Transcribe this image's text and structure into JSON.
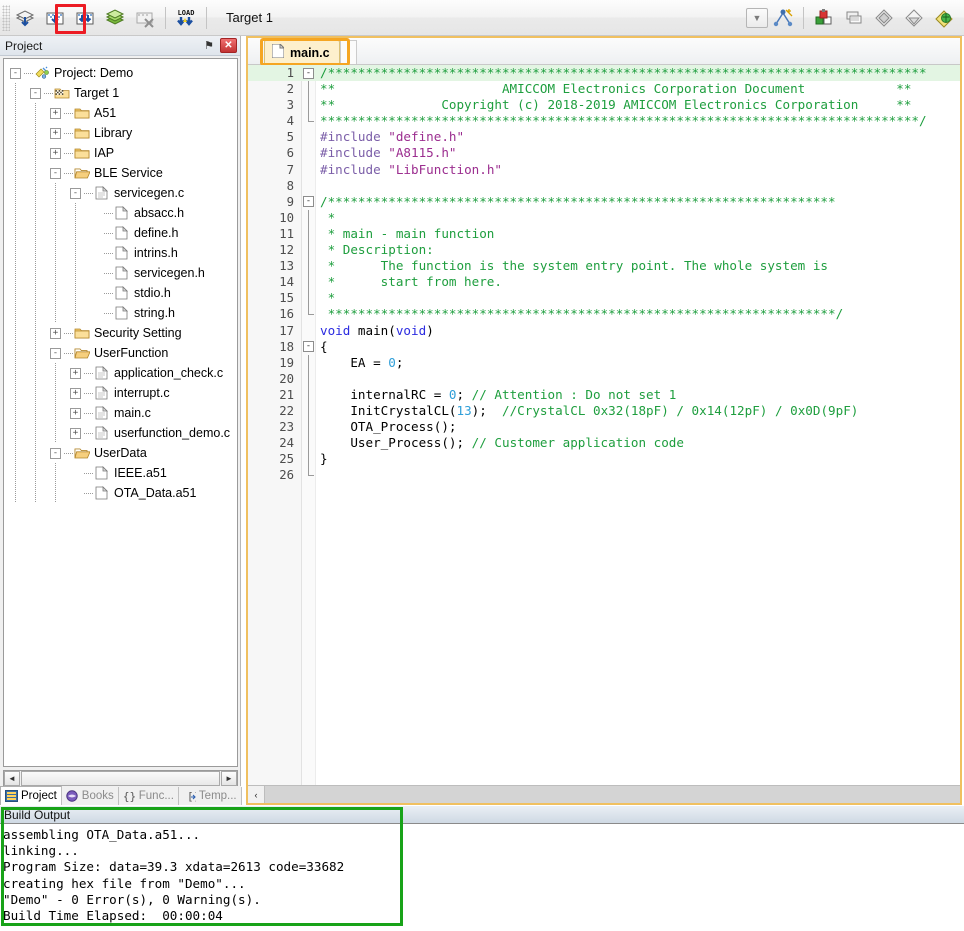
{
  "toolbar": {
    "target_value": "Target 1",
    "buttons": [
      {
        "name": "translate-icon",
        "label": "Translate"
      },
      {
        "name": "build-icon",
        "label": "Build"
      },
      {
        "name": "rebuild-icon",
        "label": "Rebuild"
      },
      {
        "name": "batch-build-icon",
        "label": "Batch Build"
      },
      {
        "name": "stop-build-icon",
        "label": "Stop Build"
      },
      {
        "name": "download-icon",
        "label": "Download"
      }
    ],
    "right_buttons": [
      {
        "name": "target-options-icon",
        "label": "Options for Target"
      },
      {
        "name": "manage-components-icon",
        "label": "Manage Project Items"
      },
      {
        "name": "manage-multi-project-icon",
        "label": "Manage Multi-Project"
      },
      {
        "name": "svcs-icon",
        "label": "Configure Source Control"
      },
      {
        "name": "svcs2-icon",
        "label": "Source Control 2"
      },
      {
        "name": "packs-icon",
        "label": "Pack Installer"
      }
    ],
    "highlight_color": "#ec1c24"
  },
  "project_panel": {
    "title": "Project",
    "pin_glyph": "⚑",
    "close_glyph": "✕",
    "tree": [
      {
        "depth": 0,
        "label": "Project: Demo",
        "icon": "project-icon",
        "toggle": "-"
      },
      {
        "depth": 1,
        "label": "Target 1",
        "icon": "target-icon",
        "toggle": "-"
      },
      {
        "depth": 2,
        "label": "A51",
        "icon": "folder-icon",
        "toggle": "+"
      },
      {
        "depth": 2,
        "label": "Library",
        "icon": "folder-icon",
        "toggle": "+"
      },
      {
        "depth": 2,
        "label": "IAP",
        "icon": "folder-icon",
        "toggle": "+"
      },
      {
        "depth": 2,
        "label": "BLE Service",
        "icon": "folder-open-icon",
        "toggle": "-"
      },
      {
        "depth": 3,
        "label": "servicegen.c",
        "icon": "c-file-icon",
        "toggle": "-"
      },
      {
        "depth": 4,
        "label": "absacc.h",
        "icon": "h-file-icon",
        "toggle": ""
      },
      {
        "depth": 4,
        "label": "define.h",
        "icon": "h-file-icon",
        "toggle": ""
      },
      {
        "depth": 4,
        "label": "intrins.h",
        "icon": "h-file-icon",
        "toggle": ""
      },
      {
        "depth": 4,
        "label": "servicegen.h",
        "icon": "h-file-icon",
        "toggle": ""
      },
      {
        "depth": 4,
        "label": "stdio.h",
        "icon": "h-file-icon",
        "toggle": ""
      },
      {
        "depth": 4,
        "label": "string.h",
        "icon": "h-file-icon",
        "toggle": ""
      },
      {
        "depth": 2,
        "label": "Security Setting",
        "icon": "folder-icon",
        "toggle": "+"
      },
      {
        "depth": 2,
        "label": "UserFunction",
        "icon": "folder-open-icon",
        "toggle": "-"
      },
      {
        "depth": 3,
        "label": "application_check.c",
        "icon": "c-file-icon",
        "toggle": "+"
      },
      {
        "depth": 3,
        "label": "interrupt.c",
        "icon": "c-file-icon",
        "toggle": "+"
      },
      {
        "depth": 3,
        "label": "main.c",
        "icon": "c-file-icon",
        "toggle": "+"
      },
      {
        "depth": 3,
        "label": "userfunction_demo.c",
        "icon": "c-file-icon",
        "toggle": "+"
      },
      {
        "depth": 2,
        "label": "UserData",
        "icon": "folder-open-icon",
        "toggle": "-"
      },
      {
        "depth": 3,
        "label": "IEEE.a51",
        "icon": "asm-file-icon",
        "toggle": ""
      },
      {
        "depth": 3,
        "label": "OTA_Data.a51",
        "icon": "asm-file-icon",
        "toggle": ""
      }
    ],
    "scroll_left_glyph": "◄",
    "scroll_right_glyph": "►",
    "tabs": [
      {
        "label": "Project",
        "icon": "project-tab-icon",
        "active": true
      },
      {
        "label": "Books",
        "icon": "books-tab-icon",
        "active": false
      },
      {
        "label": "Func...",
        "icon": "functions-tab-icon",
        "active": false
      },
      {
        "label": "Temp...",
        "icon": "templates-tab-icon",
        "active": false
      }
    ]
  },
  "editor": {
    "tab_label": "main.c",
    "tab_icon": "c-file-icon",
    "highlight_color": "#f5a623",
    "scroll_left_glyph": "‹",
    "lines": [
      {
        "n": 1,
        "fold": "-",
        "hl": true,
        "segments": [
          {
            "t": "/*******************************************************************************",
            "c": "cm"
          }
        ]
      },
      {
        "n": 2,
        "fold": "bar",
        "hl": false,
        "segments": [
          {
            "t": "**                      AMICCOM Electronics Corporation Document            **",
            "c": "cm"
          }
        ]
      },
      {
        "n": 3,
        "fold": "bar",
        "hl": false,
        "segments": [
          {
            "t": "**              Copyright (c) 2018-2019 AMICCOM Electronics Corporation     **",
            "c": "cm"
          }
        ]
      },
      {
        "n": 4,
        "fold": "end",
        "hl": false,
        "segments": [
          {
            "t": "*******************************************************************************/",
            "c": "cm"
          }
        ]
      },
      {
        "n": 5,
        "fold": "",
        "hl": false,
        "segments": [
          {
            "t": "#include ",
            "c": "pp"
          },
          {
            "t": "\"define.h\"",
            "c": "str"
          }
        ]
      },
      {
        "n": 6,
        "fold": "",
        "hl": false,
        "segments": [
          {
            "t": "#include ",
            "c": "pp"
          },
          {
            "t": "\"A8115.h\"",
            "c": "str"
          }
        ]
      },
      {
        "n": 7,
        "fold": "",
        "hl": false,
        "segments": [
          {
            "t": "#include ",
            "c": "pp"
          },
          {
            "t": "\"LibFunction.h\"",
            "c": "str"
          }
        ]
      },
      {
        "n": 8,
        "fold": "",
        "hl": false,
        "segments": []
      },
      {
        "n": 9,
        "fold": "-",
        "hl": false,
        "segments": [
          {
            "t": "/*******************************************************************",
            "c": "cm"
          }
        ]
      },
      {
        "n": 10,
        "fold": "bar",
        "hl": false,
        "segments": [
          {
            "t": " *",
            "c": "cm"
          }
        ]
      },
      {
        "n": 11,
        "fold": "bar",
        "hl": false,
        "segments": [
          {
            "t": " * main - main function",
            "c": "cm"
          }
        ]
      },
      {
        "n": 12,
        "fold": "bar",
        "hl": false,
        "segments": [
          {
            "t": " * Description:",
            "c": "cm"
          }
        ]
      },
      {
        "n": 13,
        "fold": "bar",
        "hl": false,
        "segments": [
          {
            "t": " *      The function is the system entry point. The whole system is",
            "c": "cm"
          }
        ]
      },
      {
        "n": 14,
        "fold": "bar",
        "hl": false,
        "segments": [
          {
            "t": " *      start from here.",
            "c": "cm"
          }
        ]
      },
      {
        "n": 15,
        "fold": "bar",
        "hl": false,
        "segments": [
          {
            "t": " *",
            "c": "cm"
          }
        ]
      },
      {
        "n": 16,
        "fold": "end",
        "hl": false,
        "segments": [
          {
            "t": " *******************************************************************/",
            "c": "cm"
          }
        ]
      },
      {
        "n": 17,
        "fold": "",
        "hl": false,
        "segments": [
          {
            "t": "void ",
            "c": "kw"
          },
          {
            "t": "main(",
            "c": ""
          },
          {
            "t": "void",
            "c": "kw"
          },
          {
            "t": ")",
            "c": ""
          }
        ]
      },
      {
        "n": 18,
        "fold": "-",
        "hl": false,
        "segments": [
          {
            "t": "{",
            "c": ""
          }
        ]
      },
      {
        "n": 19,
        "fold": "bar",
        "hl": false,
        "segments": [
          {
            "t": "    EA = ",
            "c": ""
          },
          {
            "t": "0",
            "c": "num"
          },
          {
            "t": ";",
            "c": ""
          }
        ]
      },
      {
        "n": 20,
        "fold": "bar",
        "hl": false,
        "segments": []
      },
      {
        "n": 21,
        "fold": "bar",
        "hl": false,
        "segments": [
          {
            "t": "    internalRC = ",
            "c": ""
          },
          {
            "t": "0",
            "c": "num"
          },
          {
            "t": "; ",
            "c": ""
          },
          {
            "t": "// Attention : Do not set 1",
            "c": "cm"
          }
        ]
      },
      {
        "n": 22,
        "fold": "bar",
        "hl": false,
        "segments": [
          {
            "t": "    InitCrystalCL(",
            "c": ""
          },
          {
            "t": "13",
            "c": "num"
          },
          {
            "t": ");  ",
            "c": ""
          },
          {
            "t": "//CrystalCL 0x32(18pF) / 0x14(12pF) / 0x0D(9pF)",
            "c": "cm"
          }
        ]
      },
      {
        "n": 23,
        "fold": "bar",
        "hl": false,
        "segments": [
          {
            "t": "    OTA_Process();",
            "c": ""
          }
        ]
      },
      {
        "n": 24,
        "fold": "bar",
        "hl": false,
        "segments": [
          {
            "t": "    User_Process(); ",
            "c": ""
          },
          {
            "t": "// Customer application code",
            "c": "cm"
          }
        ]
      },
      {
        "n": 25,
        "fold": "bar",
        "hl": false,
        "segments": [
          {
            "t": "}",
            "c": ""
          }
        ]
      },
      {
        "n": 26,
        "fold": "end",
        "hl": false,
        "segments": []
      }
    ]
  },
  "build_output": {
    "title": "Build Output",
    "highlight_color": "#18a318",
    "lines": [
      "assembling OTA_Data.a51...",
      "linking...",
      "Program Size: data=39.3 xdata=2613 code=33682",
      "creating hex file from \"Demo\"...",
      "\"Demo\" - 0 Error(s), 0 Warning(s).",
      "Build Time Elapsed:  00:00:04"
    ]
  }
}
